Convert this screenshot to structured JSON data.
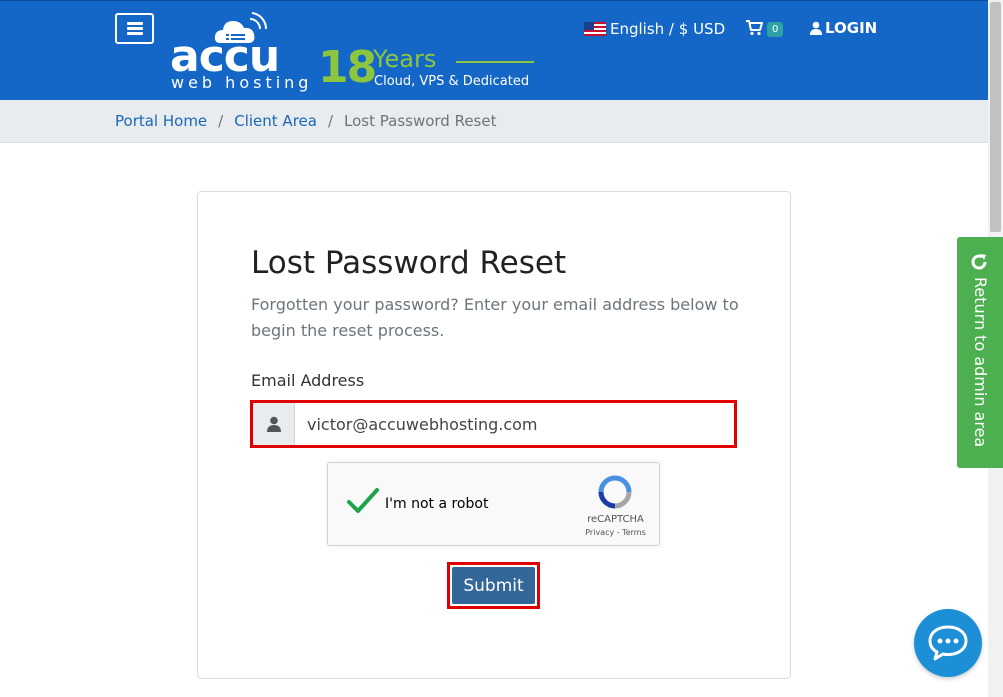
{
  "header": {
    "menu_icon": "hamburger-icon",
    "logo": {
      "brand": "accu",
      "tagline": "web hosting",
      "years_number": "18",
      "years_word": "Years",
      "services": "Cloud, VPS & Dedicated"
    },
    "language_label": "English / $ USD",
    "cart_count": "0",
    "login_label": "LOGIN"
  },
  "breadcrumb": {
    "items": [
      "Portal Home",
      "Client Area"
    ],
    "separator": "/",
    "current": "Lost Password Reset"
  },
  "form": {
    "title": "Lost Password Reset",
    "subtitle": "Forgotten your password? Enter your email address below to begin the reset process.",
    "email_label": "Email Address",
    "email_value": "victor@accuwebhosting.com",
    "recaptcha_label": "I'm not a robot",
    "recaptcha_brand": "reCAPTCHA",
    "recaptcha_links": "Privacy - Terms",
    "submit_label": "Submit"
  },
  "sidebar": {
    "admin_label": "Return to admin area"
  },
  "colors": {
    "header": "#1467c6",
    "accent_green": "#8cc63f",
    "highlight": "#e00000",
    "submit": "#336699",
    "admin_tab": "#4caf50",
    "chat": "#1c8fd6"
  }
}
